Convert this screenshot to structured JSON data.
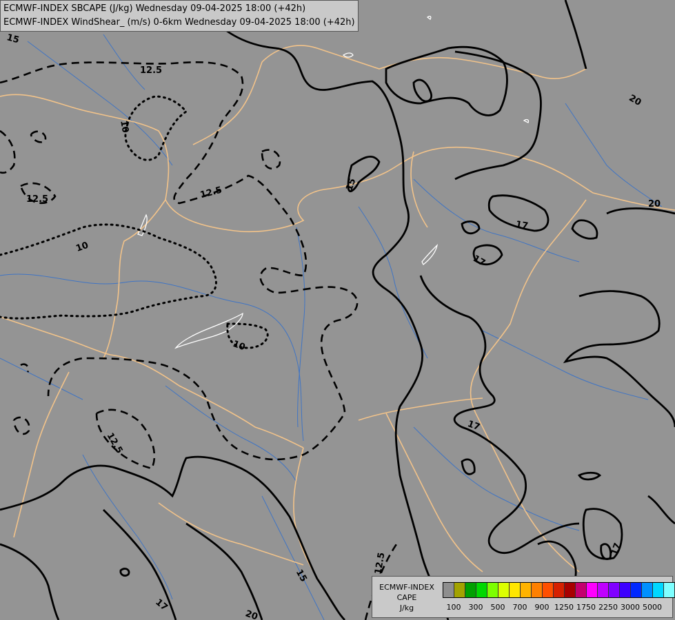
{
  "header": {
    "line1": "ECMWF-INDEX SBCAPE (J/kg) Wednesday 09-04-2025 18:00 (+42h)",
    "line2": "ECMWF-INDEX WindShear_ (m/s) 0-6km Wednesday 09-04-2025 18:00 (+42h)"
  },
  "map": {
    "background_color": "#949494",
    "border_color": "#f2c38a",
    "river_color": "#3f74c4",
    "contour_color": "#000000",
    "contour_labels": [
      "15",
      "12.5",
      "10",
      "12.5",
      "12.5",
      "10",
      "10",
      "15",
      "17",
      "17",
      "20",
      "20",
      "17",
      "12.5",
      "17",
      "15",
      "12.5",
      "17",
      "20"
    ]
  },
  "legend": {
    "title_lines": [
      "ECMWF-INDEX",
      "CAPE",
      "J/kg"
    ],
    "colors": [
      "#8e8e8e",
      "#a3a300",
      "#00a000",
      "#00d800",
      "#7cff00",
      "#dcff00",
      "#ffe600",
      "#ffb300",
      "#ff8000",
      "#ff4f00",
      "#d62000",
      "#a80000",
      "#c4006e",
      "#ff00ff",
      "#c000ff",
      "#8000ff",
      "#3c00ff",
      "#0028ff",
      "#0090ff",
      "#00d8ff",
      "#7fffff",
      "#ffffff"
    ],
    "ticks": [
      "100",
      "300",
      "500",
      "700",
      "900",
      "1250",
      "1750",
      "2250",
      "3000",
      "5000"
    ]
  }
}
